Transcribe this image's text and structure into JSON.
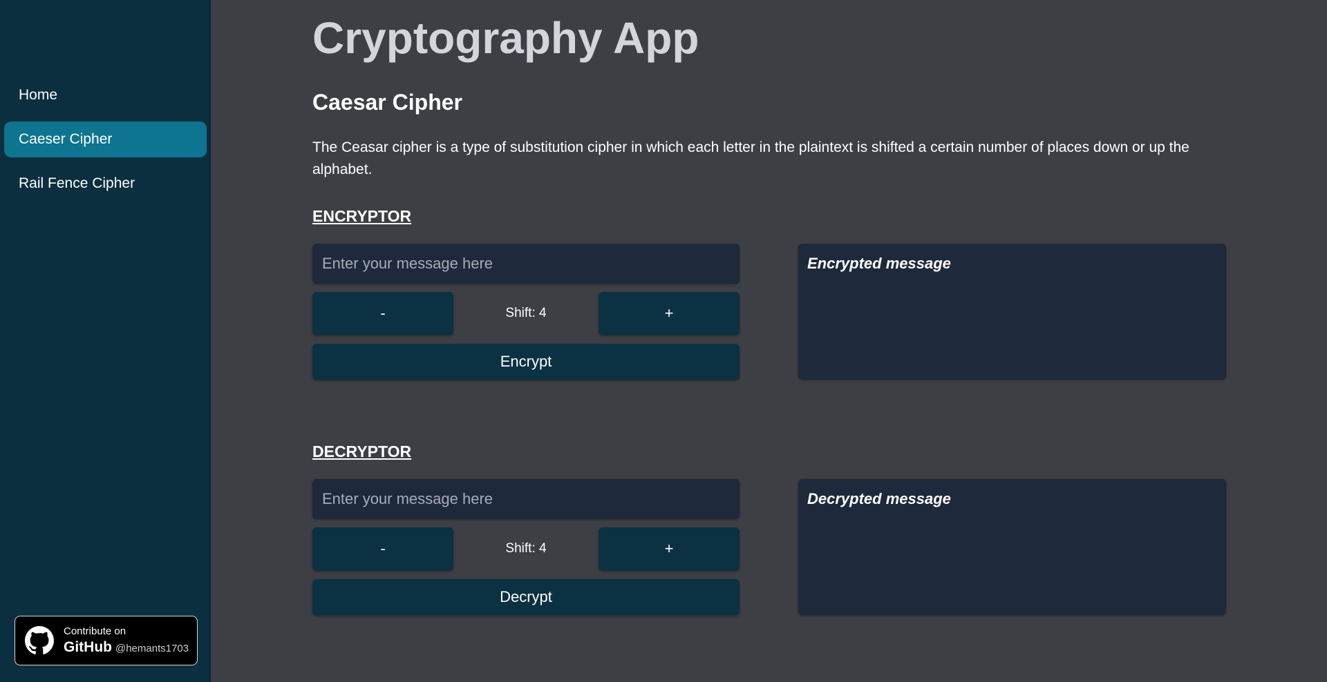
{
  "sidebar": {
    "items": [
      {
        "label": "Home",
        "active": false
      },
      {
        "label": "Caeser Cipher",
        "active": true
      },
      {
        "label": "Rail Fence Cipher",
        "active": false
      }
    ],
    "github_badge": {
      "line1": "Contribute on",
      "brand": "GitHub",
      "handle": "@hemants1703",
      "icon": "github-octocat-icon"
    }
  },
  "main": {
    "app_title": "Cryptography App",
    "section_title": "Caesar Cipher",
    "description": "The Ceasar cipher is a type of substitution cipher in which each letter in the plaintext is shifted a certain number of places down or up the alphabet.",
    "encryptor": {
      "heading": "ENCRYPTOR",
      "input_value": "",
      "input_placeholder": "Enter your message here",
      "minus_label": "-",
      "plus_label": "+",
      "shift_text": "Shift: 4",
      "action_label": "Encrypt",
      "output_label": "Encrypted message"
    },
    "decryptor": {
      "heading": "DECRYPTOR",
      "input_value": "",
      "input_placeholder": "Enter your message here",
      "minus_label": "-",
      "plus_label": "+",
      "shift_text": "Shift: 4",
      "action_label": "Decrypt",
      "output_label": "Decrypted message"
    }
  },
  "colors": {
    "background": "#3d3f44",
    "sidebar": "#0b2f3f",
    "active_nav": "#0e7490",
    "input_bg": "#1e293b",
    "button_bg": "#0b3142"
  }
}
